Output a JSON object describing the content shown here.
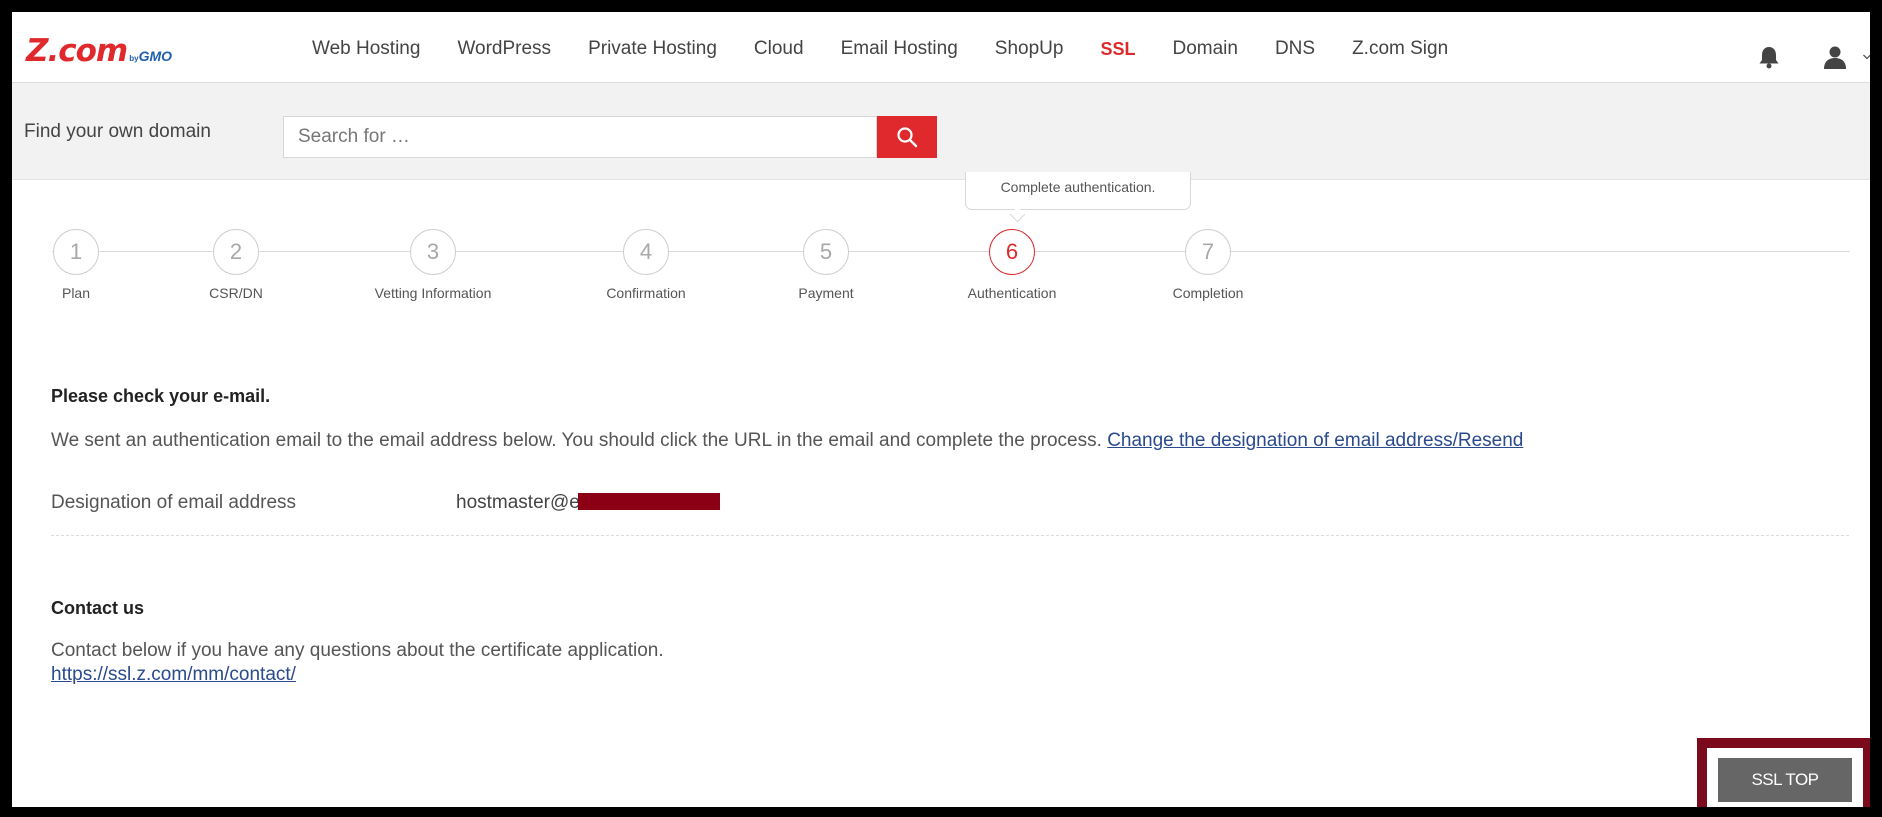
{
  "header": {
    "logo": {
      "main": "Z.com",
      "by": "by",
      "brand": "GMO"
    },
    "nav": [
      {
        "label": "Web Hosting"
      },
      {
        "label": "WordPress"
      },
      {
        "label": "Private Hosting"
      },
      {
        "label": "Cloud"
      },
      {
        "label": "Email Hosting"
      },
      {
        "label": "ShopUp"
      },
      {
        "label": "SSL",
        "active": true
      },
      {
        "label": "Domain"
      },
      {
        "label": "DNS"
      },
      {
        "label": "Z.com Sign"
      }
    ],
    "icons": [
      "bell-icon",
      "user-icon",
      "chevron-down-icon"
    ]
  },
  "search": {
    "label": "Find your own domain",
    "placeholder": "Search for …",
    "value": ""
  },
  "tooltip": "Complete authentication.",
  "steps": [
    {
      "number": "1",
      "label": "Plan"
    },
    {
      "number": "2",
      "label": "CSR/DN"
    },
    {
      "number": "3",
      "label": "Vetting Information"
    },
    {
      "number": "4",
      "label": "Confirmation"
    },
    {
      "number": "5",
      "label": "Payment"
    },
    {
      "number": "6",
      "label": "Authentication",
      "active": true
    },
    {
      "number": "7",
      "label": "Completion"
    }
  ],
  "email_section": {
    "heading": "Please check your e-mail.",
    "text": "We sent an authentication email to the email address below. You should click the URL in the email and complete the process.",
    "link": "Change the designation of email address/Resend",
    "field_label": "Designation of email address",
    "field_value": "hostmaster@e"
  },
  "contact_section": {
    "heading": "Contact us",
    "text": "Contact below if you have any questions about the certificate application.",
    "link": "https://ssl.z.com/mm/contact/"
  },
  "footer": {
    "button": "SSL TOP"
  },
  "colors": {
    "accent": "#e0292c",
    "link": "#2a4a8e",
    "highlight": "#7b0a1d",
    "button": "#666666"
  }
}
